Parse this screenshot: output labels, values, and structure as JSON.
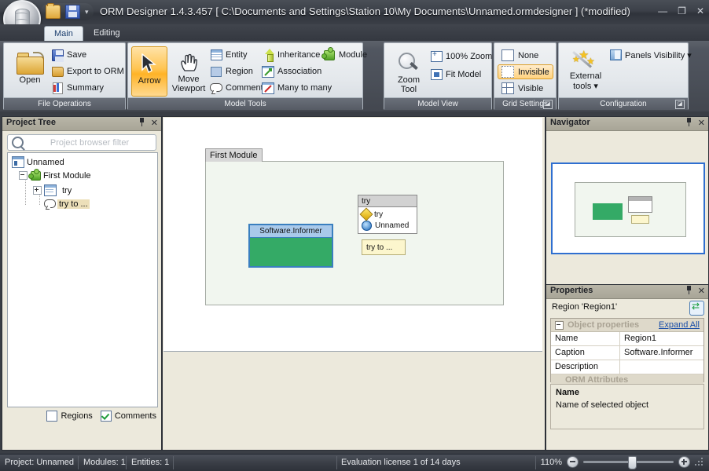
{
  "window": {
    "title": "ORM Designer 1.4.3.457 [ C:\\Documents and Settings\\Station 10\\My Documents\\Unnamed.ormdesigner ] (*modified)",
    "minimize": "—",
    "maximize": "❐",
    "close": "✕",
    "qat_dropdown": "▾"
  },
  "tabs": [
    {
      "label": "Main",
      "active": true
    },
    {
      "label": "Editing",
      "active": false
    }
  ],
  "ribbon": {
    "groups": [
      {
        "caption": "File Operations",
        "big": "Open",
        "items": [
          "Save",
          "Export to ORM",
          "Summary"
        ]
      },
      {
        "caption": "Model Tools",
        "big1": "Arrow",
        "big2": "Move Viewport",
        "big2_line1": "Move",
        "big2_line2": "Viewport",
        "items": [
          "Entity",
          "Region",
          "Comment",
          "Inheritance",
          "Association",
          "Many to many",
          "Module"
        ]
      },
      {
        "caption": "Model View",
        "big_line1": "Zoom",
        "big_line2": "Tool",
        "items": [
          "100% Zoom",
          "Fit Model"
        ]
      },
      {
        "caption": "Grid Settings",
        "items": [
          "None",
          "Invisible",
          "Visible"
        ],
        "selected": "Invisible",
        "dialog_launcher": "◪"
      },
      {
        "caption": "Configuration",
        "big_line1": "External",
        "big_line2": "tools ▾",
        "items": [
          "Panels Visibility ▾"
        ],
        "dialog_launcher": "◪"
      }
    ]
  },
  "project_tree": {
    "title": "Project Tree",
    "filter_placeholder": "Project browser filter",
    "nodes": [
      {
        "label": "Unnamed",
        "icon": "project-icon",
        "indent": 0
      },
      {
        "label": "First Module",
        "icon": "module-icon",
        "indent": 1
      },
      {
        "label": "try",
        "icon": "entity-icon",
        "indent": 2
      },
      {
        "label": "try to ...",
        "icon": "comment-icon",
        "indent": 2,
        "selected": true
      }
    ],
    "checkboxes": [
      {
        "label": "Regions",
        "checked": false
      },
      {
        "label": "Comments",
        "checked": true
      }
    ]
  },
  "canvas": {
    "module_tab": "First Module",
    "region": {
      "caption": "Software.Informer"
    },
    "entity": {
      "title": "try",
      "attributes": [
        {
          "name": "try",
          "icon": "diamond-icon"
        },
        {
          "name": "Unnamed",
          "icon": "circle-icon"
        }
      ]
    },
    "comment": {
      "text": "try to ..."
    }
  },
  "navigator": {
    "title": "Navigator"
  },
  "properties": {
    "title": "Properties",
    "object_label": "Region 'Region1'",
    "category": "Object properties",
    "expand_all": "Expand All",
    "rows": [
      {
        "key": "Name",
        "value": "Region1"
      },
      {
        "key": "Caption",
        "value": "Software.Informer"
      },
      {
        "key": "Description",
        "value": ""
      }
    ],
    "category2": "ORM Attributes",
    "help_title": "Name",
    "help_text": "Name of selected object"
  },
  "statusbar": {
    "project": "Project: Unnamed",
    "modules": "Modules: 1",
    "entities": "Entities: 1",
    "license": "Evaluation license 1 of 14 days",
    "zoom": "110%"
  }
}
